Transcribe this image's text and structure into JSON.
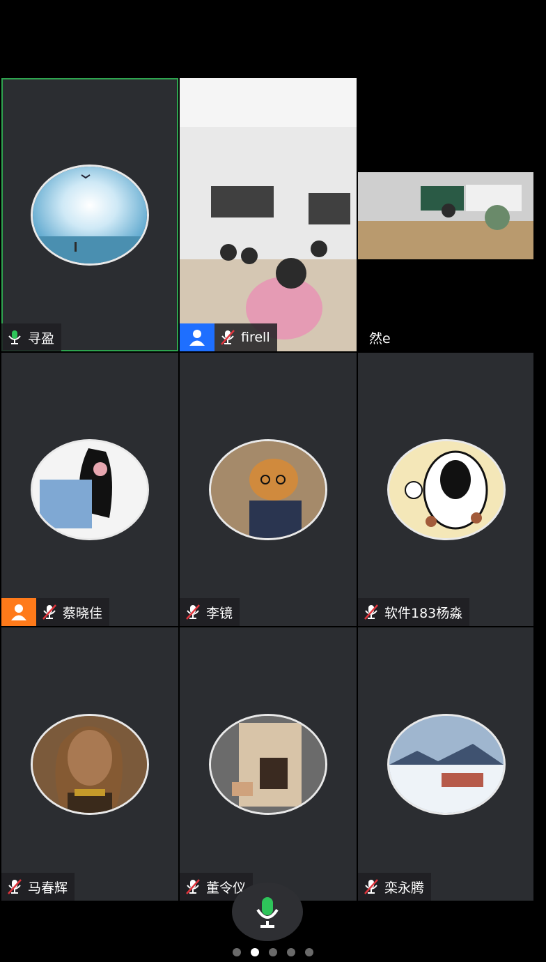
{
  "participants": [
    {
      "name": "寻盈",
      "mic": "on",
      "active": true
    },
    {
      "name": "firell",
      "mic": "muted",
      "role": "host"
    },
    {
      "name": "然e",
      "mic": "none"
    },
    {
      "name": "蔡晓佳",
      "mic": "muted",
      "role": "cohost"
    },
    {
      "name": "李镜",
      "mic": "muted"
    },
    {
      "name": "软件183杨淼",
      "mic": "muted"
    },
    {
      "name": "马春辉",
      "mic": "muted"
    },
    {
      "name": "董令仪",
      "mic": "muted"
    },
    {
      "name": "栾永腾",
      "mic": "muted"
    }
  ],
  "pager": {
    "count": 5,
    "active_index": 1
  },
  "colors": {
    "accent_green": "#2ea44f",
    "host_blue": "#1e6fff",
    "cohost_orange": "#ff7a1a",
    "muted_red": "#e0343c"
  },
  "icons": {
    "mic_on": "mic-icon",
    "mic_muted": "mic-muted-icon",
    "host": "person-icon",
    "cohost": "person-icon"
  }
}
